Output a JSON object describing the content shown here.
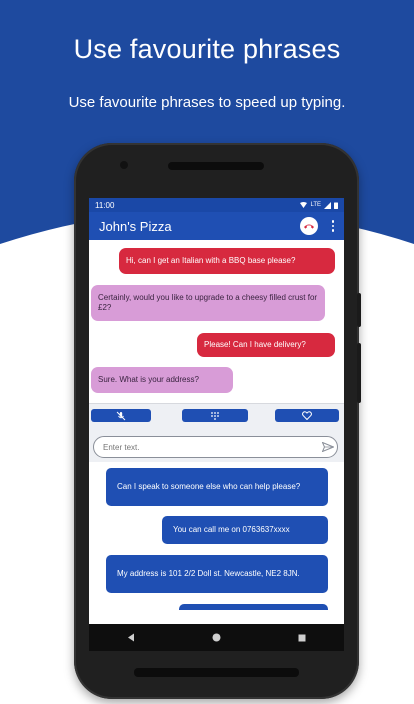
{
  "headline": "Use favourite phrases",
  "subheadline": "Use favourite phrases to speed up typing.",
  "status_bar": {
    "time": "11:00",
    "network": "LTE"
  },
  "app_bar": {
    "title": "John's Pizza"
  },
  "messages": [
    {
      "text": "Hi, can I get an Italian with a BBQ base please?",
      "from": "me"
    },
    {
      "text": "Certainly, would you like to upgrade to a cheesy filled crust for £2?",
      "from": "them"
    },
    {
      "text": "Please! Can I have delivery?",
      "from": "me"
    },
    {
      "text": "Sure. What is your address?",
      "from": "them"
    }
  ],
  "input": {
    "placeholder": "Enter text."
  },
  "phrases": [
    "Can I speak to someone else who can help please?",
    "You can call me on 0763637xxxx",
    "My address is 101 2/2 Doll st. Newcastle, NE2 8JN."
  ],
  "colors": {
    "brand_blue": "#1f4fb3",
    "hero_blue": "#1e4a9f",
    "outgoing_bubble": "#d7293f",
    "incoming_bubble": "#d89cd7"
  }
}
